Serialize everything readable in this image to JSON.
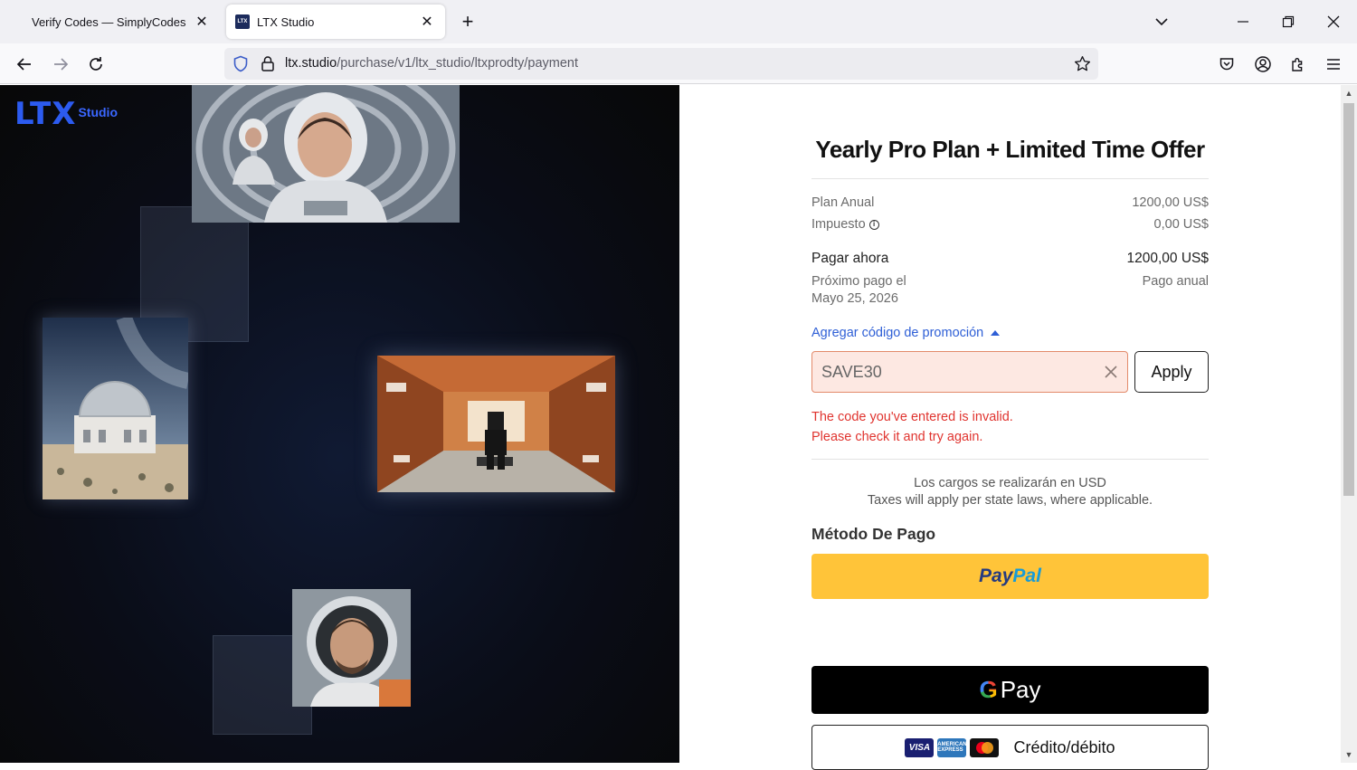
{
  "browser": {
    "tabs": [
      {
        "title": "Verify Codes — SimplyCodes",
        "active": false
      },
      {
        "title": "LTX Studio",
        "active": true,
        "favicon_text": "LTX"
      }
    ],
    "url": {
      "host": "ltx.studio",
      "path": "/purchase/v1/ltx_studio/ltxprodty/payment"
    }
  },
  "hero": {
    "logo_text": "LTX",
    "logo_sub": "Studio"
  },
  "checkout": {
    "title": "Yearly Pro Plan + Limited Time Offer",
    "plan_label": "Plan Anual",
    "plan_price": "1200,00 US$",
    "tax_label": "Impuesto",
    "tax_info_icon": "i",
    "tax_value": "0,00 US$",
    "pay_now_label": "Pagar ahora",
    "pay_now_value": "1200,00 US$",
    "next_payment_label": "Próximo pago el",
    "next_payment_date": "Mayo 25, 2026",
    "billing_cycle": "Pago anual",
    "promo_link": "Agregar código de promoción",
    "promo_code_value": "SAVE30",
    "apply_label": "Apply",
    "error_line1": "The code you've entered is invalid.",
    "error_line2": "Please check it and try again.",
    "note_line1": "Los cargos se realizarán en USD",
    "note_line2": "Taxes will apply per state laws, where applicable.",
    "payment_method_title": "Método De Pago",
    "paypal_part1": "Pay",
    "paypal_part2": "Pal",
    "gpay_g": "G",
    "gpay_label": "Pay",
    "card_brands": [
      "VISA",
      "AMERICAN EXPRESS",
      ""
    ],
    "card_label": "Crédito/débito"
  },
  "colors": {
    "accent_blue": "#2e5fd6",
    "error_red": "#e0342f",
    "paypal_yellow": "#ffc439",
    "logo_blue": "#2c5bf0"
  }
}
